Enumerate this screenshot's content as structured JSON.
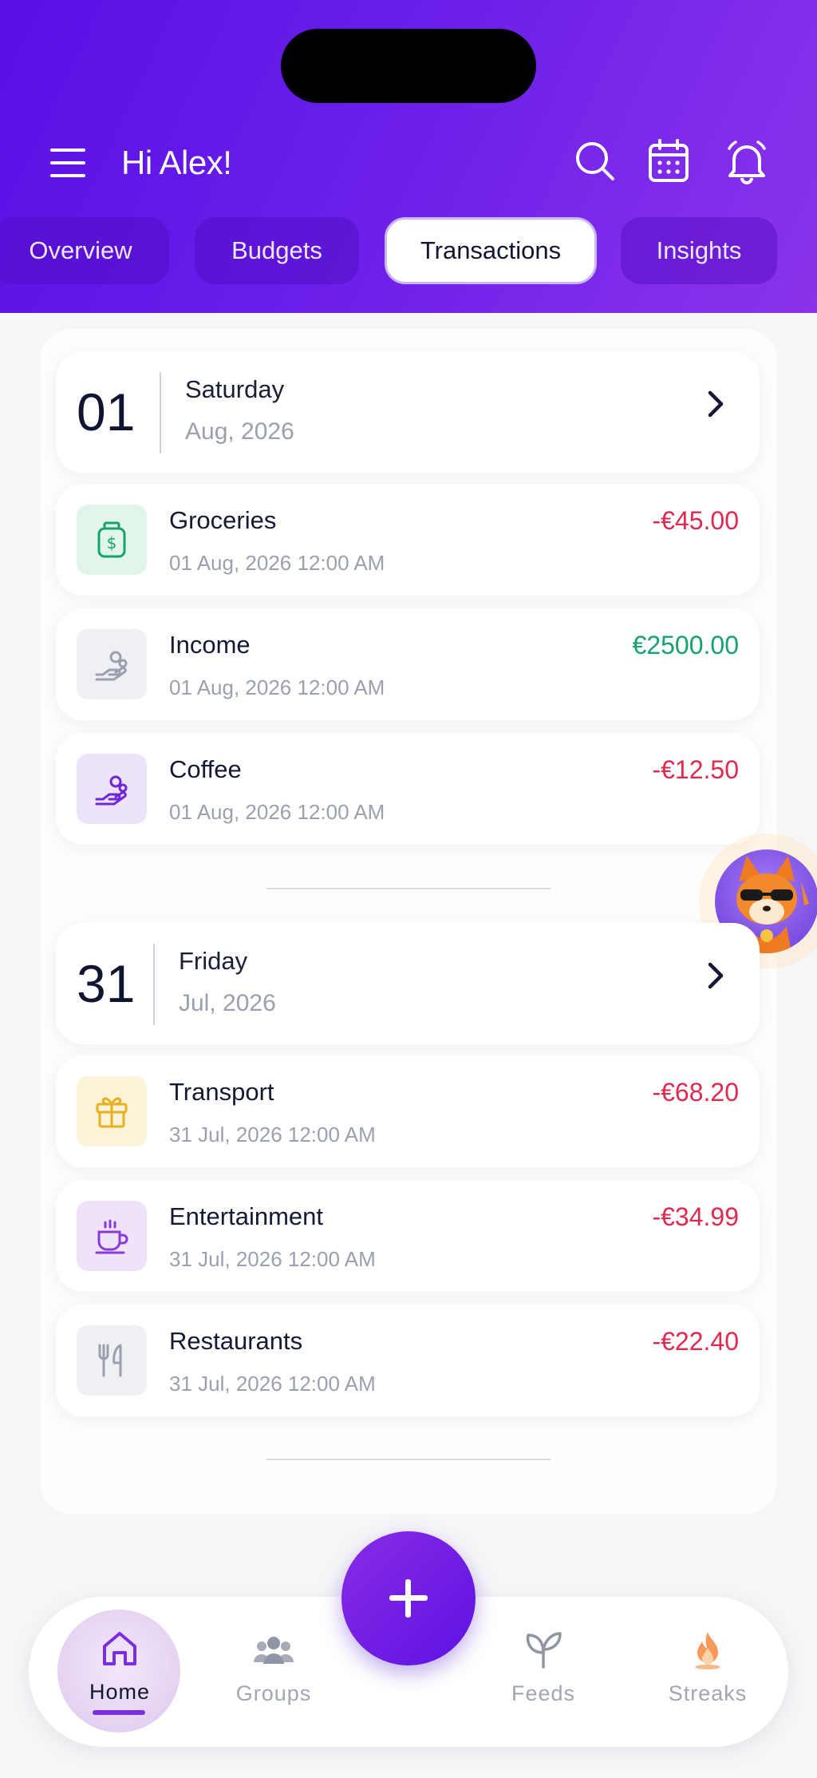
{
  "header": {
    "greeting": "Hi Alex!",
    "tabs": [
      {
        "label": "Overview",
        "active": false
      },
      {
        "label": "Budgets",
        "active": false
      },
      {
        "label": "Transactions",
        "active": true
      },
      {
        "label": "Insights",
        "active": false
      }
    ],
    "icons": [
      "menu-icon",
      "search-icon",
      "calendar-icon",
      "bell-icon"
    ]
  },
  "groups": [
    {
      "day_number": "01",
      "weekday": "Saturday",
      "month_year": "Aug, 2026",
      "transactions": [
        {
          "title": "Groceries",
          "date": "01 Aug, 2026 12:00 AM",
          "amount": "-€45.00",
          "icon": "money-bag-icon",
          "icon_bg": "#e1f5ea",
          "icon_color": "#14a36b"
        },
        {
          "title": "Income",
          "date": "01 Aug, 2026 12:00 AM",
          "amount": "€2500.00",
          "icon": "hand-coins-icon",
          "icon_bg": "#eef0f3",
          "icon_color": "#9aa0ad"
        },
        {
          "title": "Coffee",
          "date": "01 Aug, 2026 12:00 AM",
          "amount": "-€12.50",
          "icon": "hand-coins-icon",
          "icon_bg": "#ede3fb",
          "icon_color": "#6d28d9"
        }
      ]
    },
    {
      "day_number": "31",
      "weekday": "Friday",
      "month_year": "Jul, 2026",
      "transactions": [
        {
          "title": "Transport",
          "date": "31 Jul, 2026 12:00 AM",
          "amount": "-€68.20",
          "icon": "gift-icon",
          "icon_bg": "#fdf3d8",
          "icon_color": "#e8b21b"
        },
        {
          "title": "Entertainment",
          "date": "31 Jul, 2026 12:00 AM",
          "amount": "-€34.99",
          "icon": "coffee-cup-icon",
          "icon_bg": "#efe3fb",
          "icon_color": "#8a3ad9"
        },
        {
          "title": "Restaurants",
          "date": "31 Jul, 2026 12:00 AM",
          "amount": "-€22.40",
          "icon": "fork-knife-icon",
          "icon_bg": "#eef0f3",
          "icon_color": "#9aa0ad"
        }
      ]
    }
  ],
  "bottom_nav": {
    "items": [
      {
        "label": "Home",
        "icon": "home-icon",
        "active": true
      },
      {
        "label": "Groups",
        "icon": "users-icon",
        "active": false
      },
      {
        "label": "Feeds",
        "icon": "leaf-icon",
        "active": false
      },
      {
        "label": "Streaks",
        "icon": "flame-icon",
        "active": false
      }
    ],
    "fab_icon": "plus-icon"
  },
  "colors": {
    "header_gradient_start": "#5a0fe6",
    "header_gradient_end": "#8b33ea",
    "negative": "#e1284f",
    "positive": "#14a36b",
    "accent": "#7a2ee0"
  }
}
